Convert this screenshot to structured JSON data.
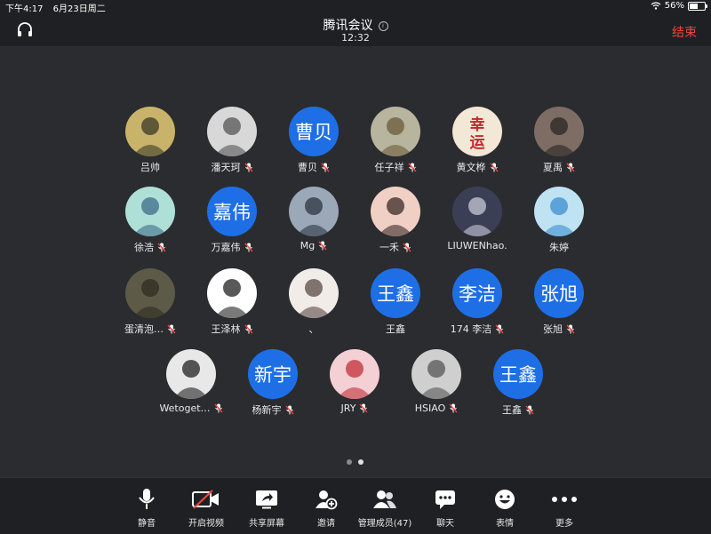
{
  "status_bar": {
    "time": "下午4:17",
    "date": "6月23日周二",
    "battery": "56%",
    "battery_level": 0.56
  },
  "header": {
    "title": "腾讯会议",
    "duration": "12:32",
    "end_label": "结束",
    "icons": [
      "headset-icon",
      "info-icon"
    ]
  },
  "participants": [
    {
      "name": "吕帅",
      "avatar_type": "image",
      "muted": false
    },
    {
      "name": "潘天珂",
      "avatar_type": "image",
      "muted": true
    },
    {
      "name": "曹贝",
      "avatar_type": "text",
      "avatar_text": "曹贝",
      "muted": true
    },
    {
      "name": "任子祥",
      "avatar_type": "image",
      "muted": true
    },
    {
      "name": "黄文桦",
      "avatar_type": "image",
      "avatar_text": "幸运",
      "muted": true
    },
    {
      "name": "夏禹",
      "avatar_type": "image",
      "muted": true
    },
    {
      "name": "徐浩",
      "avatar_type": "image",
      "muted": true
    },
    {
      "name": "万嘉伟",
      "avatar_type": "text",
      "avatar_text": "嘉伟",
      "muted": true
    },
    {
      "name": "Mg",
      "avatar_type": "image",
      "muted": true
    },
    {
      "name": "一禾",
      "avatar_type": "image",
      "muted": true
    },
    {
      "name": "LIUWENhao.",
      "avatar_type": "image",
      "muted": false
    },
    {
      "name": "朱婷",
      "avatar_type": "image",
      "muted": false
    },
    {
      "name": "蛋清泡…",
      "avatar_type": "image",
      "muted": true
    },
    {
      "name": "王泽林",
      "avatar_type": "image",
      "muted": true
    },
    {
      "name": "、",
      "avatar_type": "image",
      "muted": false
    },
    {
      "name": "王鑫",
      "avatar_type": "text",
      "avatar_text": "王鑫",
      "muted": false
    },
    {
      "name": "174 李洁",
      "avatar_type": "text",
      "avatar_text": "李洁",
      "muted": true
    },
    {
      "name": "张旭",
      "avatar_type": "text",
      "avatar_text": "张旭",
      "muted": true
    },
    {
      "name": "Wetoget…",
      "avatar_type": "image",
      "muted": true
    },
    {
      "name": "杨新宇",
      "avatar_type": "text",
      "avatar_text": "新宇",
      "muted": true
    },
    {
      "name": "JRY",
      "avatar_type": "image",
      "muted": true
    },
    {
      "name": "HSIAO",
      "avatar_type": "image",
      "muted": true
    },
    {
      "name": "王鑫",
      "avatar_type": "text",
      "avatar_text": "王鑫",
      "muted": true
    }
  ],
  "pager": {
    "pages": 2,
    "current": 2
  },
  "toolbar": [
    {
      "label": "静音",
      "icon": "microphone-icon"
    },
    {
      "label": "开启视频",
      "icon": "video-off-icon"
    },
    {
      "label": "共享屏幕",
      "icon": "share-screen-icon"
    },
    {
      "label": "邀请",
      "icon": "invite-icon"
    },
    {
      "label": "管理成员(47)",
      "icon": "members-icon"
    },
    {
      "label": "聊天",
      "icon": "chat-icon"
    },
    {
      "label": "表情",
      "icon": "emoji-icon"
    },
    {
      "label": "更多",
      "icon": "more-icon"
    }
  ],
  "colors": {
    "background": "#2b2c30",
    "bar": "#1f2023",
    "avatar_blue": "#1e6fe6",
    "end_red": "#f1453d"
  }
}
